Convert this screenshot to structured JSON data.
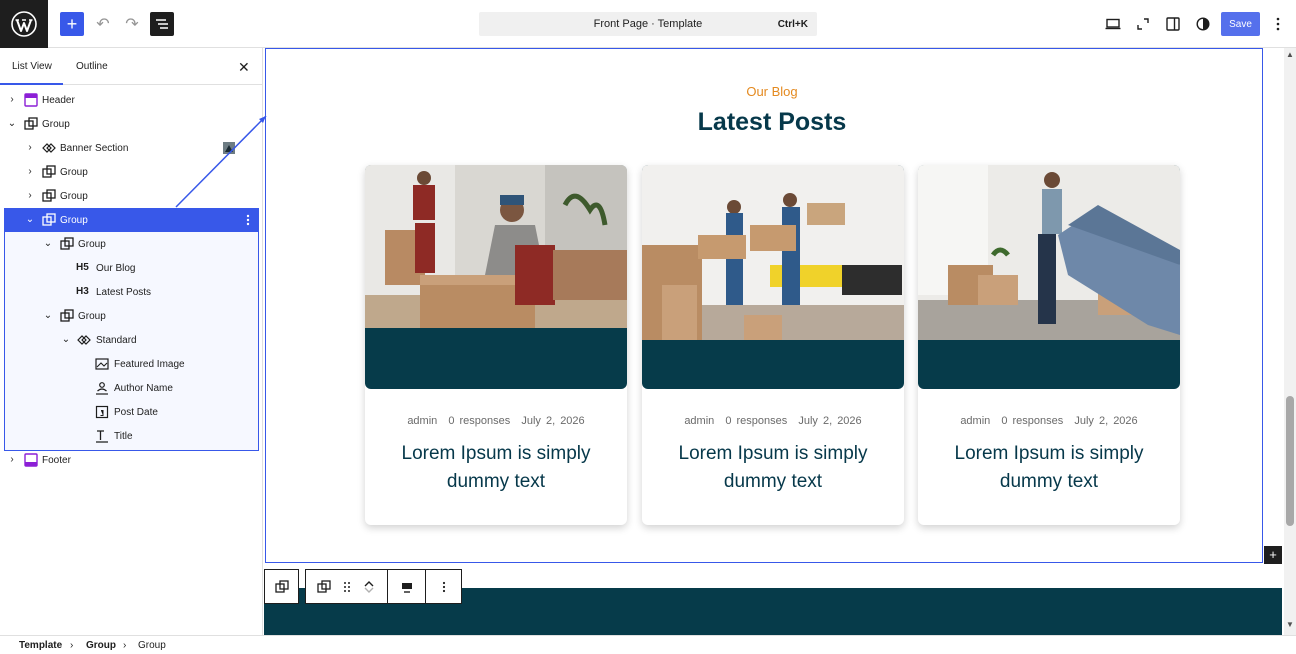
{
  "topbar": {
    "command_title": "Front Page · Template",
    "command_shortcut": "Ctrl+K",
    "save_label": "Save"
  },
  "panel": {
    "tabs": [
      "List View",
      "Outline"
    ],
    "active_tab": "List View"
  },
  "tree": [
    {
      "label": "Header",
      "icon": "template-part-icon"
    },
    {
      "label": "Group",
      "icon": "group-icon"
    },
    {
      "label": "Banner Section",
      "icon": "pattern-icon"
    },
    {
      "label": "Group",
      "icon": "group-icon"
    },
    {
      "label": "Group",
      "icon": "group-icon"
    },
    {
      "label": "Group",
      "icon": "group-icon",
      "selected": true
    },
    {
      "label": "Group",
      "icon": "group-icon"
    },
    {
      "label": "Our Blog",
      "badge": "H5",
      "icon": "heading-icon"
    },
    {
      "label": "Latest Posts",
      "badge": "H3",
      "icon": "heading-icon"
    },
    {
      "label": "Group",
      "icon": "group-icon"
    },
    {
      "label": "Standard",
      "icon": "pattern-icon"
    },
    {
      "label": "Featured Image",
      "icon": "image-icon"
    },
    {
      "label": "Author Name",
      "icon": "author-icon"
    },
    {
      "label": "Post Date",
      "icon": "calendar-icon"
    },
    {
      "label": "Title",
      "icon": "title-icon"
    },
    {
      "label": "Footer",
      "icon": "template-part-icon"
    }
  ],
  "blog": {
    "eyebrow": "Our Blog",
    "heading": "Latest Posts"
  },
  "cards": [
    {
      "author": "admin",
      "responses": "0 responses",
      "date": "July 2, 2026",
      "title": "Lorem Ipsum is simply dummy text"
    },
    {
      "author": "admin",
      "responses": "0 responses",
      "date": "July 2, 2026",
      "title": "Lorem Ipsum is simply dummy text"
    },
    {
      "author": "admin",
      "responses": "0 responses",
      "date": "July 2, 2026",
      "title": "Lorem Ipsum is simply dummy text"
    }
  ],
  "breadcrumb": [
    "Template",
    "Group",
    "Group"
  ],
  "colors": {
    "accent": "#3858e9",
    "brand_dark": "#06384a",
    "eyebrow": "#e48a20"
  }
}
